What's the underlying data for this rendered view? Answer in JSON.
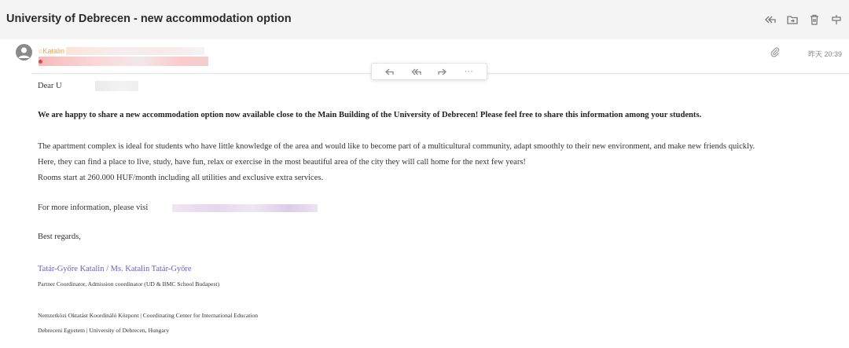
{
  "header": {
    "subject": "University of Debrecen - new accommodation option",
    "actions": [
      {
        "name": "reply-all-icon"
      },
      {
        "name": "move-folder-icon"
      },
      {
        "name": "delete-icon"
      },
      {
        "name": "pin-icon"
      }
    ]
  },
  "sender": {
    "name_visible": "○Katalin T",
    "time": "昨天 20:39"
  },
  "floating_toolbar": {
    "more_label": "···"
  },
  "body": {
    "greeting": "Dear U",
    "intro": "We are happy to share a new accommodation option now available close to the Main Building of the University of Debrecen! Please feel free to share this information among your students.",
    "p1": "The apartment complex is ideal for students who have little knowledge of the area and would like to become part of a multicultural community, adapt smoothly to their new environment, and make new friends quickly.",
    "p2": "Here, they can find a place to live, study, have fun, relax or exercise in the most beautiful area of the city they will call home for the next few years!",
    "p3": "Rooms start at 260.000 HUF/month including all utilities and exclusive extra services.",
    "more_info": "For more information, please visi",
    "regards": "Best regards,"
  },
  "signature": {
    "name": "Tatár-Győre Katalin / Ms. Katalin Tatár-Győre",
    "role": "Partner Coordinator, Admission coordinator (UD & BMC School Budapest)",
    "center": "Nemzetközi Oktatást Koordináló Központ | Coordinating Center for International Education",
    "university": "Debreceni Egyetem | University of Debrecen, Hungary"
  },
  "colors": {
    "accent_link": "#6b63b2",
    "sender_orange": "#f2a13a",
    "header_bg": "#f4f4f5"
  }
}
